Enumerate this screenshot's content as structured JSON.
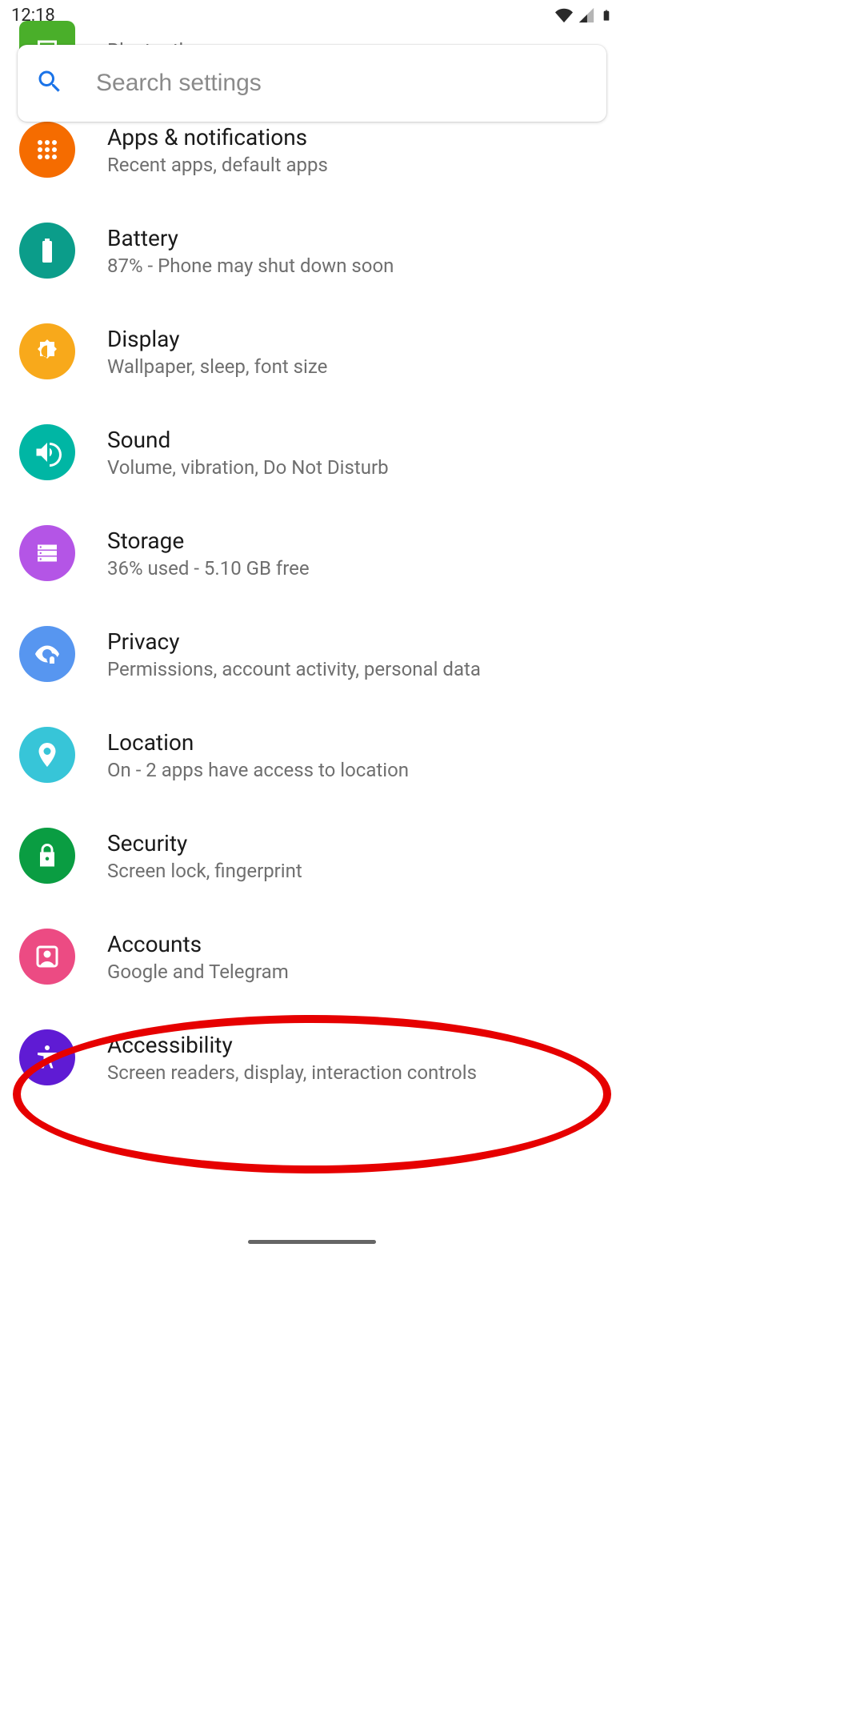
{
  "statusbar": {
    "time": "12:18"
  },
  "search": {
    "placeholder": "Search settings"
  },
  "items": [
    {
      "title": "",
      "sub": "Bluetooth"
    },
    {
      "title": "Apps & notifications",
      "sub": "Recent apps, default apps"
    },
    {
      "title": "Battery",
      "sub": "87% - Phone may shut down soon"
    },
    {
      "title": "Display",
      "sub": "Wallpaper, sleep, font size"
    },
    {
      "title": "Sound",
      "sub": "Volume, vibration, Do Not Disturb"
    },
    {
      "title": "Storage",
      "sub": "36% used - 5.10 GB free"
    },
    {
      "title": "Privacy",
      "sub": "Permissions, account activity, personal data"
    },
    {
      "title": "Location",
      "sub": "On - 2 apps have access to location"
    },
    {
      "title": "Security",
      "sub": "Screen lock, fingerprint"
    },
    {
      "title": "Accounts",
      "sub": "Google and Telegram"
    },
    {
      "title": "Accessibility",
      "sub": "Screen readers, display, interaction controls"
    }
  ]
}
